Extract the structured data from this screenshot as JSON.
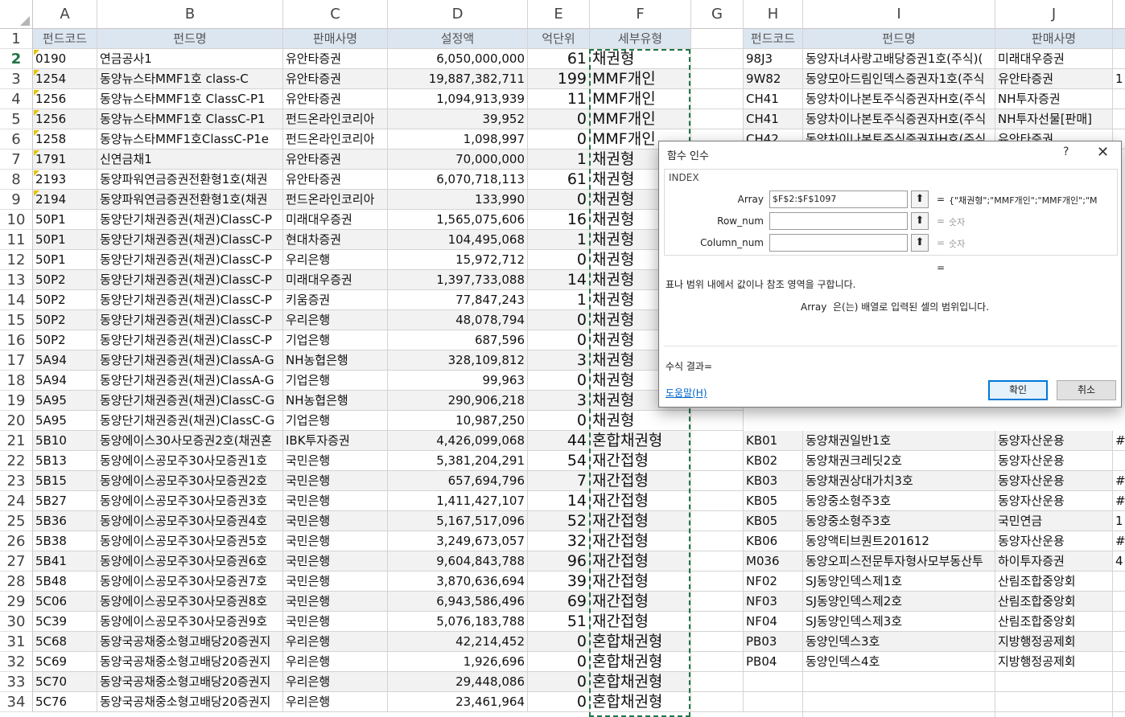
{
  "columns_left": [
    "A",
    "B",
    "C",
    "D",
    "E",
    "F",
    "G"
  ],
  "columns_right": [
    "H",
    "I",
    "J"
  ],
  "header_row": {
    "number": "1",
    "left": [
      "펀드코드",
      "펀드명",
      "판매사명",
      "설정액",
      "억단위",
      "세부유형"
    ],
    "right": [
      "펀드코드",
      "펀드명",
      "판매사명"
    ]
  },
  "rows_left": [
    {
      "n": "2",
      "a": "0190",
      "b": "연금공사1",
      "c": "유안타증권",
      "d": "6,050,000,000",
      "e": "61",
      "f": "채권형"
    },
    {
      "n": "3",
      "a": "1254",
      "b": "동양뉴스타MMF1호 class-C",
      "c": "유안타증권",
      "d": "19,887,382,711",
      "e": "199",
      "f": "MMF개인"
    },
    {
      "n": "4",
      "a": "1256",
      "b": "동양뉴스타MMF1호 ClassC-P1",
      "c": "유안타증권",
      "d": "1,094,913,939",
      "e": "11",
      "f": "MMF개인"
    },
    {
      "n": "5",
      "a": "1256",
      "b": "동양뉴스타MMF1호 ClassC-P1",
      "c": "펀드온라인코리아",
      "d": "39,952",
      "e": "0",
      "f": "MMF개인"
    },
    {
      "n": "6",
      "a": "1258",
      "b": "동양뉴스타MMF1호ClassC-P1e",
      "c": "펀드온라인코리아",
      "d": "1,098,997",
      "e": "0",
      "f": "MMF개인"
    },
    {
      "n": "7",
      "a": "1791",
      "b": "신연금채1",
      "c": "유안타증권",
      "d": "70,000,000",
      "e": "1",
      "f": "채권형"
    },
    {
      "n": "8",
      "a": "2193",
      "b": "동양파워연금증권전환형1호(채권",
      "c": "유안타증권",
      "d": "6,070,718,113",
      "e": "61",
      "f": "채권형"
    },
    {
      "n": "9",
      "a": "2194",
      "b": "동양파워연금증권전환형1호(채권",
      "c": "펀드온라인코리아",
      "d": "133,990",
      "e": "0",
      "f": "채권형"
    },
    {
      "n": "10",
      "a": "50P1",
      "b": "동양단기채권증권(채권)ClassC-P",
      "c": "미래대우증권",
      "d": "1,565,075,606",
      "e": "16",
      "f": "채권형"
    },
    {
      "n": "11",
      "a": "50P1",
      "b": "동양단기채권증권(채권)ClassC-P",
      "c": "현대차증권",
      "d": "104,495,068",
      "e": "1",
      "f": "채권형"
    },
    {
      "n": "12",
      "a": "50P1",
      "b": "동양단기채권증권(채권)ClassC-P",
      "c": "우리은행",
      "d": "15,972,712",
      "e": "0",
      "f": "채권형"
    },
    {
      "n": "13",
      "a": "50P2",
      "b": "동양단기채권증권(채권)ClassC-P",
      "c": "미래대우증권",
      "d": "1,397,733,088",
      "e": "14",
      "f": "채권형"
    },
    {
      "n": "14",
      "a": "50P2",
      "b": "동양단기채권증권(채권)ClassC-P",
      "c": "키움증권",
      "d": "77,847,243",
      "e": "1",
      "f": "채권형"
    },
    {
      "n": "15",
      "a": "50P2",
      "b": "동양단기채권증권(채권)ClassC-P",
      "c": "우리은행",
      "d": "48,078,794",
      "e": "0",
      "f": "채권형"
    },
    {
      "n": "16",
      "a": "50P2",
      "b": "동양단기채권증권(채권)ClassC-P",
      "c": "기업은행",
      "d": "687,596",
      "e": "0",
      "f": "채권형"
    },
    {
      "n": "17",
      "a": "5A94",
      "b": "동양단기채권증권(채권)ClassA-G",
      "c": "NH농협은행",
      "d": "328,109,812",
      "e": "3",
      "f": "채권형"
    },
    {
      "n": "18",
      "a": "5A94",
      "b": "동양단기채권증권(채권)ClassA-G",
      "c": "기업은행",
      "d": "99,963",
      "e": "0",
      "f": "채권형"
    },
    {
      "n": "19",
      "a": "5A95",
      "b": "동양단기채권증권(채권)ClassC-G",
      "c": "NH농협은행",
      "d": "290,906,218",
      "e": "3",
      "f": "채권형"
    },
    {
      "n": "20",
      "a": "5A95",
      "b": "동양단기채권증권(채권)ClassC-G",
      "c": "기업은행",
      "d": "10,987,250",
      "e": "0",
      "f": "채권형"
    },
    {
      "n": "21",
      "a": "5B10",
      "b": "동양에이스30사모증권2호(채권혼",
      "c": "IBK투자증권",
      "d": "4,426,099,068",
      "e": "44",
      "f": "혼합채권형"
    },
    {
      "n": "22",
      "a": "5B13",
      "b": "동양에이스공모주30사모증권1호",
      "c": "국민은행",
      "d": "5,381,204,291",
      "e": "54",
      "f": "재간접형"
    },
    {
      "n": "23",
      "a": "5B15",
      "b": "동양에이스공모주30사모증권2호",
      "c": "국민은행",
      "d": "657,694,796",
      "e": "7",
      "f": "재간접형"
    },
    {
      "n": "24",
      "a": "5B27",
      "b": "동양에이스공모주30사모증권3호",
      "c": "국민은행",
      "d": "1,411,427,107",
      "e": "14",
      "f": "재간접형"
    },
    {
      "n": "25",
      "a": "5B36",
      "b": "동양에이스공모주30사모증권4호",
      "c": "국민은행",
      "d": "5,167,517,096",
      "e": "52",
      "f": "재간접형"
    },
    {
      "n": "26",
      "a": "5B38",
      "b": "동양에이스공모주30사모증권5호",
      "c": "국민은행",
      "d": "3,249,673,057",
      "e": "32",
      "f": "재간접형"
    },
    {
      "n": "27",
      "a": "5B41",
      "b": "동양에이스공모주30사모증권6호",
      "c": "국민은행",
      "d": "9,604,843,788",
      "e": "96",
      "f": "재간접형"
    },
    {
      "n": "28",
      "a": "5B48",
      "b": "동양에이스공모주30사모증권7호",
      "c": "국민은행",
      "d": "3,870,636,694",
      "e": "39",
      "f": "재간접형"
    },
    {
      "n": "29",
      "a": "5C06",
      "b": "동양에이스공모주30사모증권8호",
      "c": "국민은행",
      "d": "6,943,586,496",
      "e": "69",
      "f": "재간접형"
    },
    {
      "n": "30",
      "a": "5C39",
      "b": "동양에이스공모주30사모증권9호",
      "c": "국민은행",
      "d": "5,076,183,788",
      "e": "51",
      "f": "재간접형"
    },
    {
      "n": "31",
      "a": "5C68",
      "b": "동양국공채중소형고배당20증권지",
      "c": "우리은행",
      "d": "42,214,452",
      "e": "0",
      "f": "혼합채권형"
    },
    {
      "n": "32",
      "a": "5C69",
      "b": "동양국공채중소형고배당20증권지",
      "c": "우리은행",
      "d": "1,926,696",
      "e": "0",
      "f": "혼합채권형"
    },
    {
      "n": "33",
      "a": "5C70",
      "b": "동양국공채중소형고배당20증권지",
      "c": "우리은행",
      "d": "29,448,086",
      "e": "0",
      "f": "혼합채권형"
    },
    {
      "n": "34",
      "a": "5C76",
      "b": "동양국공채중소형고배당20증권지",
      "c": "우리은행",
      "d": "23,461,964",
      "e": "0",
      "f": "혼합채권형"
    }
  ],
  "rows_right_top": [
    {
      "h": "98J3",
      "i": "동양자녀사랑고배당증권1호(주식)(",
      "j": "미래대우증권",
      "k": ""
    },
    {
      "h": "9W82",
      "i": "동양모아드림인덱스증권자1호(주식",
      "j": "유안타증권",
      "k": "1"
    },
    {
      "h": "CH41",
      "i": "동양차이나본토주식증권자H호(주식",
      "j": "NH투자증권",
      "k": ""
    },
    {
      "h": "CH41",
      "i": "동양차이나본토주식증권자H호(주식",
      "j": "NH투자선물[판매]",
      "k": ""
    },
    {
      "h": "CH42",
      "i": "동양차이나본토주식증권자H호(주식",
      "j": "유안타증권",
      "k": ""
    }
  ],
  "rows_right_bottom": [
    {
      "h": "KB01",
      "i": "동양채권일반1호",
      "j": "동양자산운용",
      "k": "#"
    },
    {
      "h": "KB02",
      "i": "동양채권크레딧2호",
      "j": "동양자산운용",
      "k": ""
    },
    {
      "h": "KB03",
      "i": "동양채권상대가치3호",
      "j": "동양자산운용",
      "k": "#"
    },
    {
      "h": "KB05",
      "i": "동양중소형주3호",
      "j": "동양자산운용",
      "k": "#"
    },
    {
      "h": "KB05",
      "i": "동양중소형주3호",
      "j": "국민연금",
      "k": "1"
    },
    {
      "h": "KB06",
      "i": "동양액티브퀀트201612",
      "j": "동양자산운용",
      "k": "#"
    },
    {
      "h": "M036",
      "i": "동양오피스전문투자형사모부동산투",
      "j": "하이투자증권",
      "k": "4"
    },
    {
      "h": "NF02",
      "i": "SJ동양인덱스제1호",
      "j": "산림조합중앙회",
      "k": ""
    },
    {
      "h": "NF03",
      "i": "SJ동양인덱스제2호",
      "j": "산림조합중앙회",
      "k": ""
    },
    {
      "h": "NF04",
      "i": "SJ동양인덱스제3호",
      "j": "산림조합중앙회",
      "k": ""
    },
    {
      "h": "PB03",
      "i": "동양인덱스3호",
      "j": "지방행정공제회",
      "k": ""
    },
    {
      "h": "PB04",
      "i": "동양인덱스4호",
      "j": "지방행정공제회",
      "k": ""
    }
  ],
  "dialog": {
    "title": "함수 인수",
    "help_icon": "?",
    "close_icon": "✕",
    "function_name": "INDEX",
    "args": [
      {
        "label": "Array",
        "value": "$F$2:$F$1097",
        "result": "{\"채권형\";\"MMF개인\";\"MMF개인\";\"M"
      },
      {
        "label": "Row_num",
        "value": "",
        "result": "숫자"
      },
      {
        "label": "Column_num",
        "value": "",
        "result": "숫자"
      }
    ],
    "eq": "=",
    "description": "표나 범위 내에서 값이나 참조 영역을 구합니다.",
    "arg_description_name": "Array",
    "arg_description": "은(는) 배열로 입력된 셀의 범위입니다.",
    "formula_result_label": "수식 결과=",
    "help_link": "도움말(H)",
    "ok_label": "확인",
    "cancel_label": "취소"
  },
  "colors": {
    "accent": "#217346",
    "header_fill": "#dce6f1",
    "alt_row": "#f2f2f2",
    "dialog_ok_border": "#0078d7"
  }
}
